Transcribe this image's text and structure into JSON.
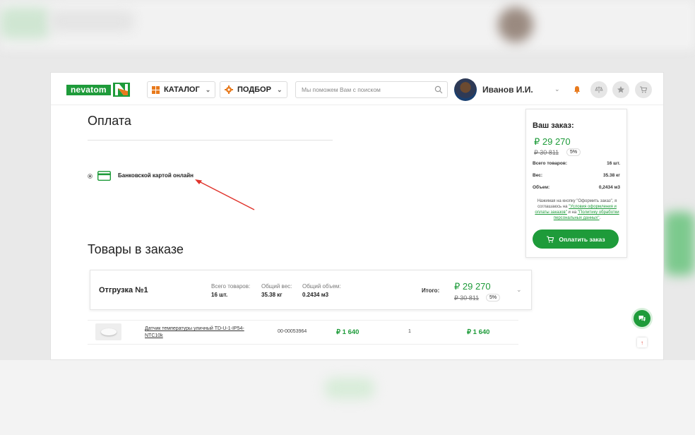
{
  "header": {
    "logo_text": "nevatom",
    "catalog_label": "КАТАЛОГ",
    "selection_label": "ПОДБОР",
    "search_placeholder": "Мы поможем Вам с поиском",
    "user_name": "Иванов И.И."
  },
  "payment": {
    "title": "Оплата",
    "method_label": "Банковской картой онлайн"
  },
  "goods": {
    "title": "Товары в заказе",
    "shipment": {
      "title": "Отгрузка №1",
      "total_items_label": "Всего товаров:",
      "total_items_value": "16 шт.",
      "weight_label": "Общий вес:",
      "weight_value": "35.38 кг",
      "volume_label": "Общий объем:",
      "volume_value": "0.2434 м3",
      "itogo_label": "Итого:",
      "total": "₽ 29 270",
      "old_total": "₽ 30 811",
      "discount": "5%"
    },
    "items": [
      {
        "name": "Датчик температуры уличный TD-U-1-IP54-NTC10k",
        "code": "00-00053964",
        "price": "₽ 1 640",
        "qty": "1",
        "sum": "₽ 1 640"
      }
    ]
  },
  "order": {
    "title": "Ваш заказ:",
    "total": "₽ 29 270",
    "old_total": "₽ 30 811",
    "discount": "5%",
    "items_label": "Всего товаров:",
    "items_value": "16 шт.",
    "weight_label": "Вес:",
    "weight_value": "35.38 кг",
    "volume_label": "Объем:",
    "volume_value": "0,2434 м3",
    "note_prefix": "Нажимая на кнопку \"Оформить заказ\", я соглашаюсь на ",
    "note_link1": "\"Условия оформления и оплаты заказов\"",
    "note_mid": " и на ",
    "note_link2": "\"Политику обработки персональных данных\"",
    "note_suffix": ".",
    "pay_button": "Оплатить заказ"
  },
  "colors": {
    "brand_green": "#1e9b3a",
    "accent_orange": "#e87a1d",
    "arrow_red": "#e0342c"
  }
}
